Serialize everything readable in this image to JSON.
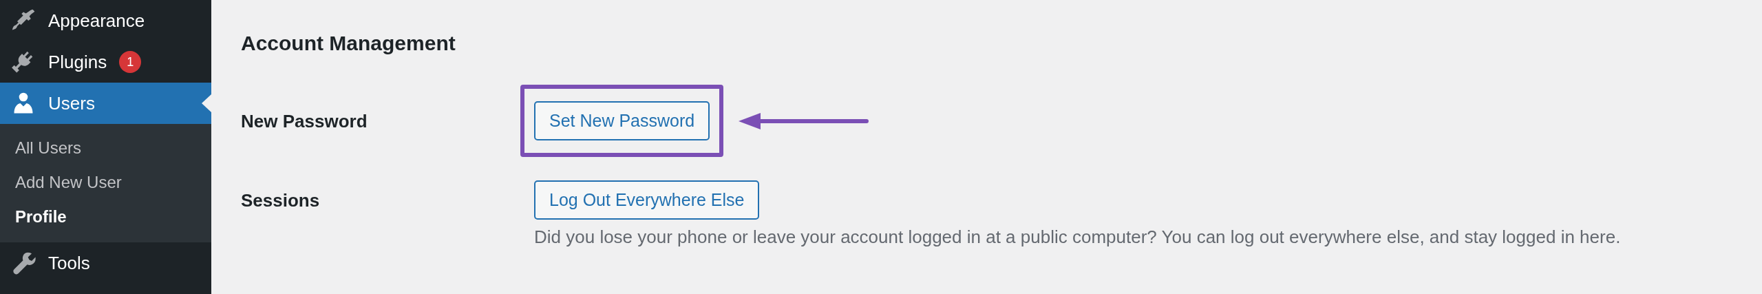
{
  "sidebar": {
    "items": [
      {
        "label": "Appearance",
        "kind": "brush",
        "selected": false
      },
      {
        "label": "Plugins",
        "kind": "plug",
        "badge": "1",
        "selected": false
      },
      {
        "label": "Users",
        "kind": "user",
        "selected": true,
        "children": [
          {
            "label": "All Users",
            "selected": false
          },
          {
            "label": "Add New User",
            "selected": false
          },
          {
            "label": "Profile",
            "selected": true
          }
        ]
      },
      {
        "label": "Tools",
        "kind": "wrench",
        "selected": false
      }
    ]
  },
  "main": {
    "heading": "Account Management",
    "rows": [
      {
        "label": "New Password",
        "button": "Set New Password",
        "highlighted": true
      },
      {
        "label": "Sessions",
        "button": "Log Out Everywhere Else",
        "highlighted": false,
        "description": "Did you lose your phone or leave your account logged in at a public computer? You can log out everywhere else, and stay logged in here."
      }
    ]
  }
}
